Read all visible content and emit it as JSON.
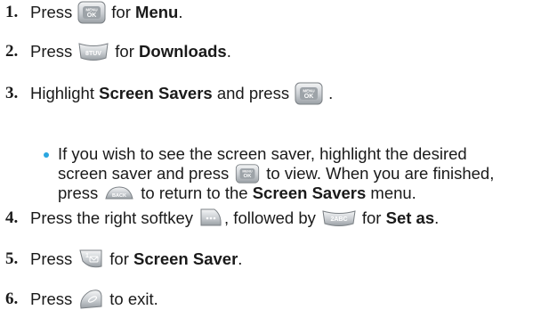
{
  "steps": [
    {
      "num": "1.",
      "parts": {
        "a": "Press",
        "b": "for",
        "c": "Menu",
        "d": "."
      },
      "key": "menu-ok-key-icon"
    },
    {
      "num": "2.",
      "parts": {
        "a": "Press",
        "b": "for",
        "c": "Downloads",
        "d": "."
      },
      "key": "8tuv-key-icon"
    },
    {
      "num": "3.",
      "parts": {
        "a": "Highlight",
        "b": "Screen Savers",
        "c": "and press",
        "d": "."
      },
      "key": "menu-ok-key-icon"
    },
    {
      "num": "4.",
      "parts": {
        "a": "Press the right softkey",
        "b": ", followed by",
        "c": "for",
        "d": "Set as",
        "e": "."
      },
      "keys": [
        "right-softkey-icon",
        "2abc-key-icon"
      ]
    },
    {
      "num": "5.",
      "parts": {
        "a": "Press",
        "b": "for",
        "c": "Screen Saver",
        "d": "."
      },
      "key": "1-voicemail-key-icon"
    },
    {
      "num": "6.",
      "parts": {
        "a": "Press",
        "b": "to exit."
      },
      "key": "end-key-icon"
    }
  ],
  "bullet": {
    "line1": "If you wish to see the screen saver, highlight the desired",
    "line2a": "screen saver and press",
    "line2b": "to view. When you are finished,",
    "line3a": "press",
    "line3b": "to return to the",
    "line3c": "Screen Savers",
    "line3d": "menu."
  },
  "key_labels": {
    "menu_top": "MENU",
    "ok": "OK",
    "eight": "8TUV",
    "two": "2ABC",
    "back": "BACK",
    "one": "1"
  },
  "colors": {
    "bullet": "#2aa6e0",
    "text": "#1a1a1a",
    "key_body": "#cfd3d6",
    "key_edge": "#7b8085"
  }
}
